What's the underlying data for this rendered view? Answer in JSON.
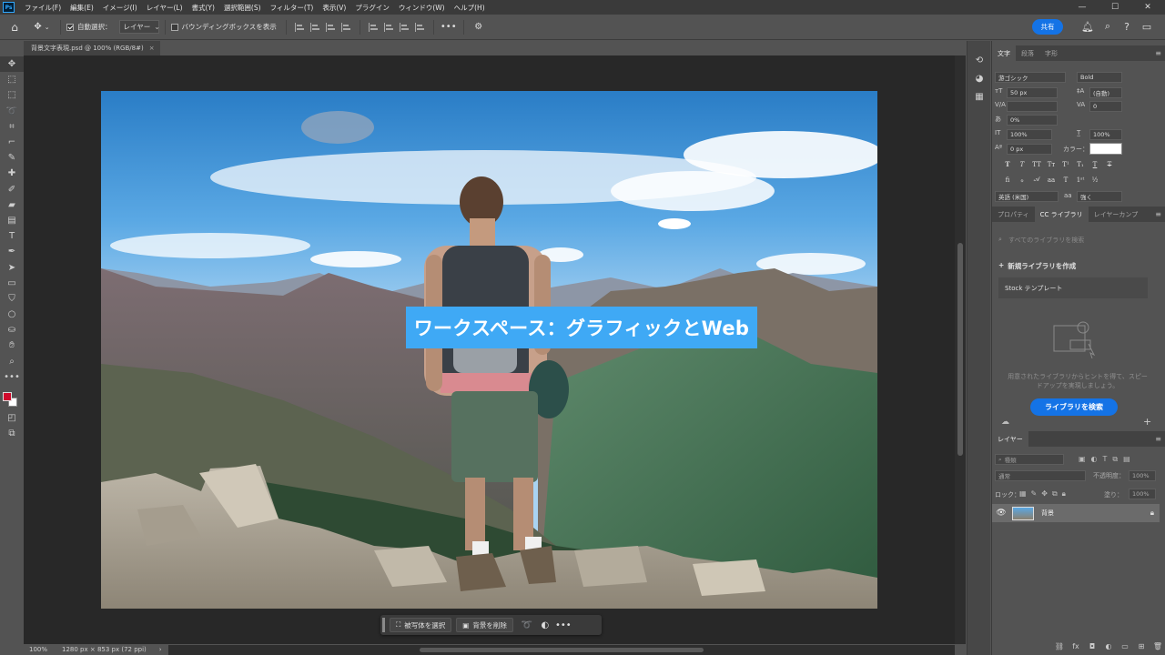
{
  "app": {
    "logo": "Ps"
  },
  "menu": [
    "ファイル(F)",
    "編集(E)",
    "イメージ(I)",
    "レイヤー(L)",
    "書式(Y)",
    "選択範囲(S)",
    "フィルター(T)",
    "表示(V)",
    "プラグイン",
    "ウィンドウ(W)",
    "ヘルプ(H)"
  ],
  "window_controls": {
    "minimize": "—",
    "maximize": "☐",
    "close": "✕"
  },
  "options_bar": {
    "auto_select_label": "自動選択：",
    "auto_select_checked": true,
    "target_dropdown": "レイヤー",
    "bounding_box_label": "バウンディングボックスを表示",
    "bounding_box_checked": false,
    "more": "•••",
    "share_label": "共有"
  },
  "document": {
    "tab_title": "背景文字表現.psd @ 100% (RGB/8#)",
    "tab_close": "×"
  },
  "canvas": {
    "headline": "ワークスペース：グラフィックとWeb",
    "headline_color": "#3fa9f5"
  },
  "context_bar": {
    "select_subject": "被写体を選択",
    "remove_background": "背景を削除",
    "more": "•••"
  },
  "status": {
    "zoom": "100%",
    "doc_info": "1280 px × 853 px (72 ppi)"
  },
  "character_panel": {
    "tabs": [
      "文字",
      "段落",
      "字形"
    ],
    "font_family": "游ゴシック",
    "font_style": "Bold",
    "font_size": "50 px",
    "leading": "(自動)",
    "kerning": "",
    "tracking": "0",
    "tsume": "0%",
    "vertical_scale": "100%",
    "horizontal_scale": "100%",
    "baseline_shift": "0 px",
    "color_label": "カラー：",
    "text_color": "#ffffff",
    "style_buttons": [
      "T",
      "T",
      "TT",
      "Tт",
      "T¹",
      "T₁",
      "T",
      "T"
    ],
    "language": "英語 (米国)",
    "anti_alias_icon": "aa",
    "anti_alias": "強く"
  },
  "libraries_panel": {
    "tabs": [
      "プロパティ",
      "CC ライブラリ",
      "レイヤーカンプ"
    ],
    "search_placeholder": "すべてのライブラリを検索",
    "new_library": "新規ライブラリを作成",
    "stock_item": "Stock テンプレート",
    "empty_text": "用意されたライブラリからヒントを得て、スピードアップを実現しましょう。",
    "browse_button": "ライブラリを検索"
  },
  "layers_panel": {
    "tab": "レイヤー",
    "filter_label": "種類",
    "blend_mode": "通常",
    "opacity_label": "不透明度：",
    "opacity": "100%",
    "lock_label": "ロック：",
    "fill_label": "塗り：",
    "fill": "100%",
    "layers": [
      {
        "name": "背景",
        "visible": true,
        "locked": true
      }
    ]
  }
}
